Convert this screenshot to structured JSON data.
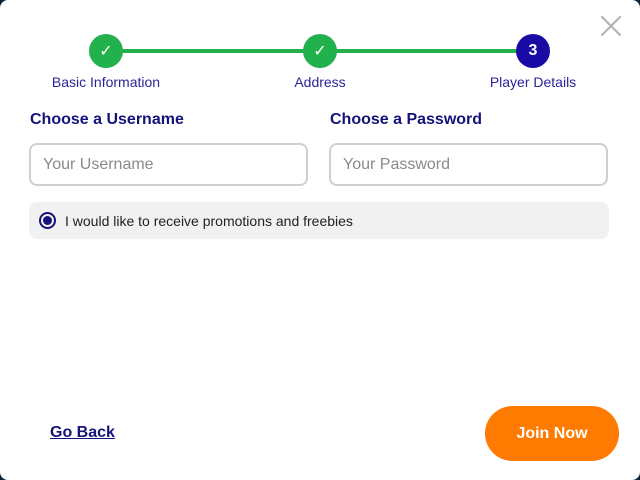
{
  "dialog": {
    "close_icon": "close-icon"
  },
  "stepper": {
    "steps": [
      {
        "label": "Basic Information",
        "state": "complete",
        "icon": "checkmark-icon",
        "glyph": "✓"
      },
      {
        "label": "Address",
        "state": "complete",
        "icon": "checkmark-icon",
        "glyph": "✓"
      },
      {
        "label": "Player Details",
        "state": "current",
        "number": "3"
      }
    ],
    "complete_color": "#22b14c",
    "current_color": "#1a0aa6"
  },
  "form": {
    "username": {
      "label": "Choose a Username",
      "placeholder": "Your Username",
      "value": ""
    },
    "password": {
      "label": "Choose a Password",
      "placeholder": "Your Password",
      "value": ""
    },
    "promotions": {
      "label": "I would like to receive promotions and freebies",
      "selected": true
    }
  },
  "footer": {
    "back_label": "Go Back",
    "submit_label": "Join Now",
    "submit_color": "#ff7a00"
  }
}
